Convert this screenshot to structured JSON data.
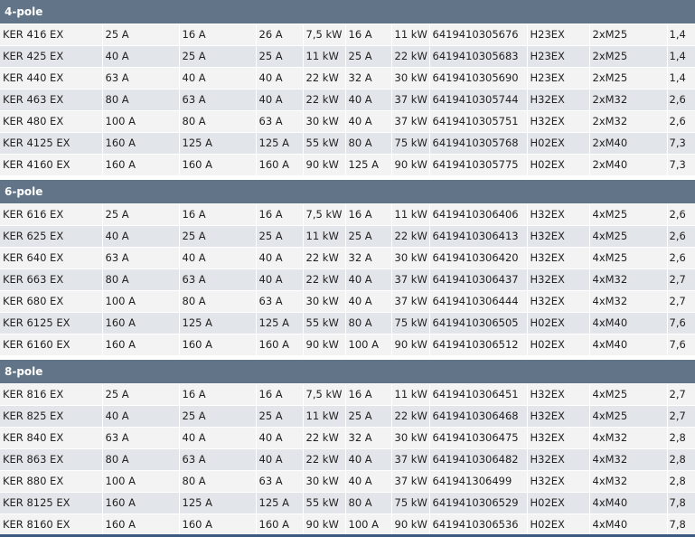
{
  "colors": {
    "header_bg": "#627487",
    "header_text": "#ffffff",
    "row_odd_bg": "#f3f3f3",
    "row_even_bg": "#e2e5e9",
    "bottom_bar": "#3c5a80"
  },
  "groups": [
    {
      "title": "4-pole",
      "rows": [
        [
          "KER 416 EX",
          "25 A",
          "16 A",
          "26 A",
          "7,5 kW",
          "16 A",
          "11 kW",
          "6419410305676",
          "H23EX",
          "2xM25",
          "1,4"
        ],
        [
          "KER 425 EX",
          "40 A",
          "25 A",
          "25 A",
          "11 kW",
          "25 A",
          "22 kW",
          "6419410305683",
          "H23EX",
          "2xM25",
          "1,4"
        ],
        [
          "KER 440 EX",
          "63 A",
          "40 A",
          "40 A",
          "22 kW",
          "32 A",
          "30 kW",
          "6419410305690",
          "H23EX",
          "2xM25",
          "1,4"
        ],
        [
          "KER 463 EX",
          "80 A",
          "63 A",
          "40 A",
          "22 kW",
          "40 A",
          "37 kW",
          "6419410305744",
          "H32EX",
          "2xM32",
          "2,6"
        ],
        [
          "KER 480 EX",
          "100 A",
          "80 A",
          "63 A",
          "30 kW",
          "40 A",
          "37 kW",
          "6419410305751",
          "H32EX",
          "2xM32",
          "2,6"
        ],
        [
          "KER 4125 EX",
          "160 A",
          "125 A",
          "125 A",
          "55 kW",
          "80 A",
          "75 kW",
          "6419410305768",
          "H02EX",
          "2xM40",
          "7,3"
        ],
        [
          "KER 4160 EX",
          "160 A",
          "160 A",
          "160 A",
          "90 kW",
          "125 A",
          "90 kW",
          "6419410305775",
          "H02EX",
          "2xM40",
          "7,3"
        ]
      ]
    },
    {
      "title": "6-pole",
      "rows": [
        [
          "KER 616 EX",
          "25 A",
          "16 A",
          "16 A",
          "7,5 kW",
          "16 A",
          "11 kW",
          "6419410306406",
          "H32EX",
          "4xM25",
          "2,6"
        ],
        [
          "KER 625 EX",
          "40 A",
          "25 A",
          "25 A",
          "11 kW",
          "25 A",
          "22 kW",
          "6419410306413",
          "H32EX",
          "4xM25",
          "2,6"
        ],
        [
          "KER 640 EX",
          "63 A",
          "40 A",
          "40 A",
          "22 kW",
          "32 A",
          "30 kW",
          "6419410306420",
          "H32EX",
          "4xM25",
          "2,6"
        ],
        [
          "KER 663 EX",
          "80 A",
          "63 A",
          "40 A",
          "22 kW",
          "40 A",
          "37 kW",
          "6419410306437",
          "H32EX",
          "4xM32",
          "2,7"
        ],
        [
          "KER 680 EX",
          "100 A",
          "80 A",
          "63 A",
          "30 kW",
          "40 A",
          "37 kW",
          "6419410306444",
          "H32EX",
          "4xM32",
          "2,7"
        ],
        [
          "KER 6125 EX",
          "160 A",
          "125 A",
          "125 A",
          "55 kW",
          "80 A",
          "75 kW",
          "6419410306505",
          "H02EX",
          "4xM40",
          "7,6"
        ],
        [
          "KER 6160 EX",
          "160 A",
          "160 A",
          "160 A",
          "90 kW",
          "100 A",
          "90 kW",
          "6419410306512",
          "H02EX",
          "4xM40",
          "7,6"
        ]
      ]
    },
    {
      "title": "8-pole",
      "rows": [
        [
          "KER 816 EX",
          "25 A",
          "16 A",
          "16 A",
          "7,5 kW",
          "16 A",
          "11 kW",
          "6419410306451",
          "H32EX",
          "4xM25",
          "2,7"
        ],
        [
          "KER 825 EX",
          "40 A",
          "25 A",
          "25 A",
          "11 kW",
          "25 A",
          "22 kW",
          "6419410306468",
          "H32EX",
          "4xM25",
          "2,7"
        ],
        [
          "KER 840 EX",
          "63 A",
          "40 A",
          "40 A",
          "22 kW",
          "32 A",
          "30 kW",
          "6419410306475",
          "H32EX",
          "4xM32",
          "2,8"
        ],
        [
          "KER 863 EX",
          "80 A",
          "63 A",
          "40 A",
          "22 kW",
          "40 A",
          "37 kW",
          "6419410306482",
          "H32EX",
          "4xM32",
          "2,8"
        ],
        [
          "KER 880 EX",
          "100 A",
          "80 A",
          "63 A",
          "30 kW",
          "40 A",
          "37 kW",
          "641941306499",
          "H32EX",
          "4xM32",
          "2,8"
        ],
        [
          "KER 8125 EX",
          "160 A",
          "125 A",
          "125 A",
          "55 kW",
          "80 A",
          "75 kW",
          "6419410306529",
          "H02EX",
          "4xM40",
          "7,8"
        ],
        [
          "KER 8160 EX",
          "160 A",
          "160 A",
          "160 A",
          "90 kW",
          "100 A",
          "90 kW",
          "6419410306536",
          "H02EX",
          "4xM40",
          "7,8"
        ]
      ]
    }
  ]
}
